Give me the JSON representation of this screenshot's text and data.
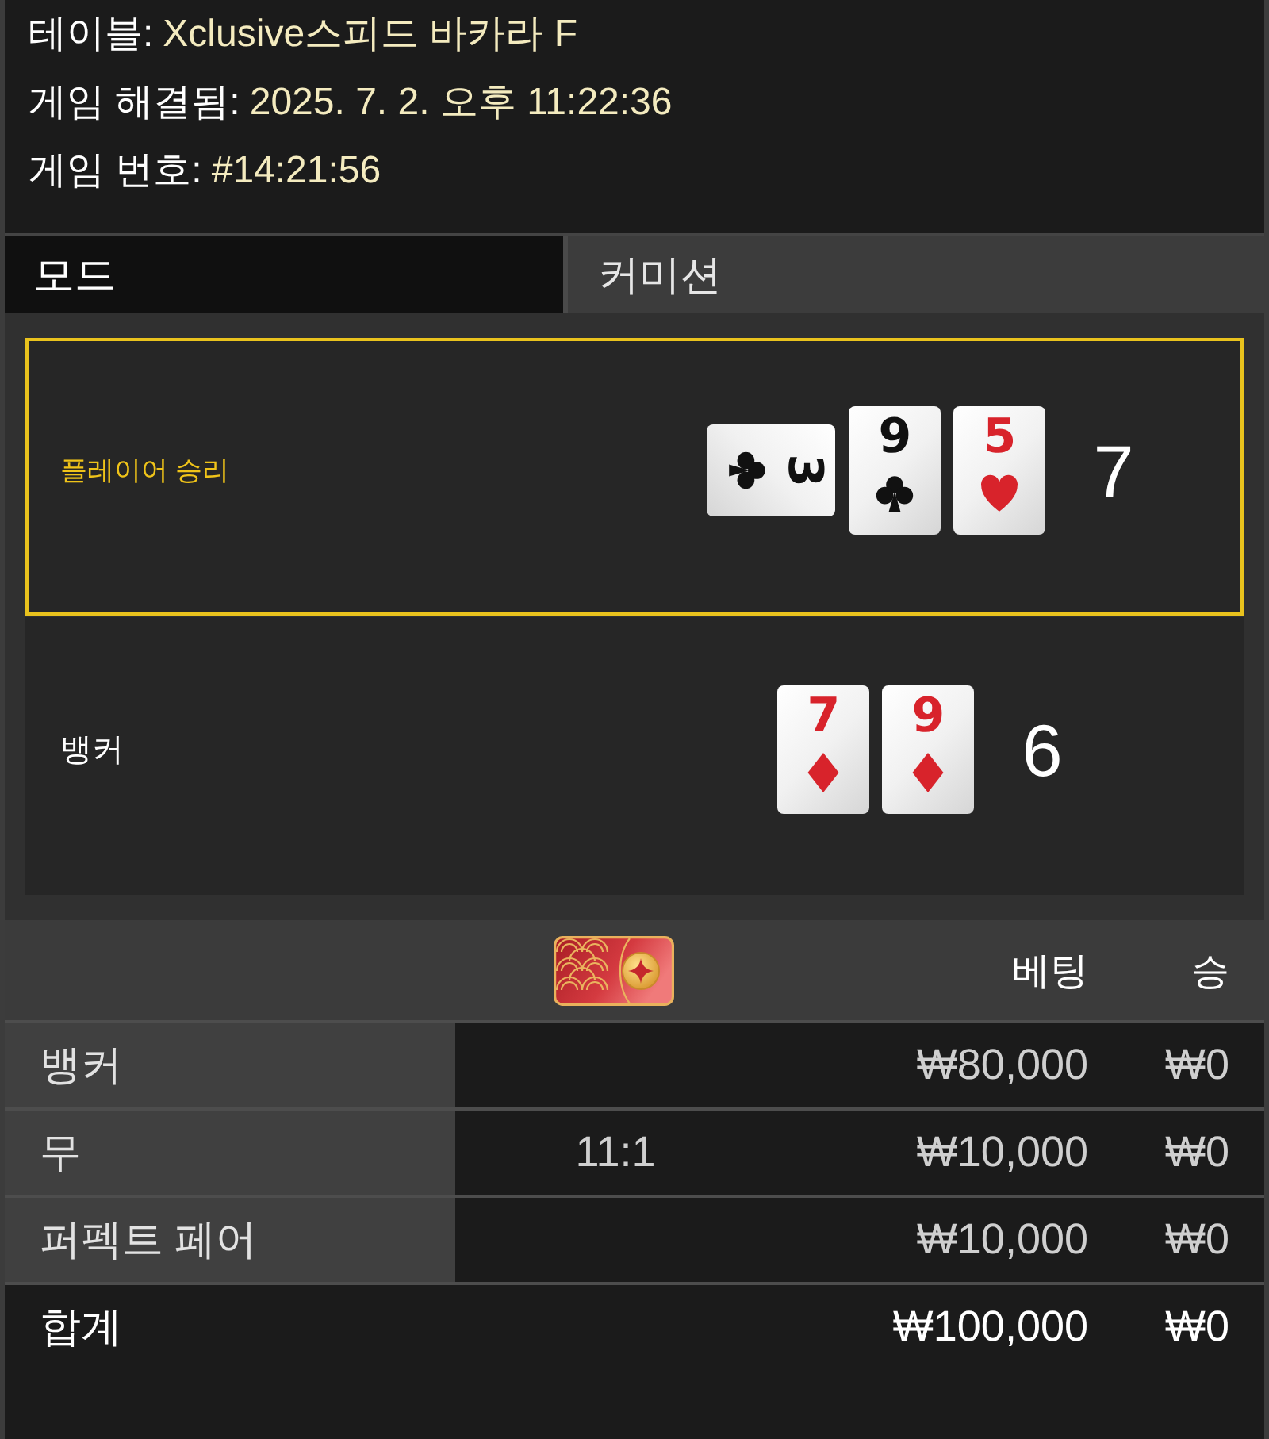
{
  "info": [
    {
      "label": "테이블:",
      "value": "Xclusive스피드 바카라 F"
    },
    {
      "label": "게임 해결됨:",
      "value": "2025. 7. 2. 오후 11:22:36"
    },
    {
      "label": "게임 번호:",
      "value": "#14:21:56"
    }
  ],
  "mode": {
    "label": "모드",
    "value": "커미션"
  },
  "hands": [
    {
      "label": "플레이어 승리",
      "winner": true,
      "cards": [
        {
          "rank": "3",
          "kind": "club",
          "sideways": true
        },
        {
          "rank": "9",
          "kind": "club",
          "sideways": false
        },
        {
          "rank": "5",
          "kind": "heart",
          "sideways": false
        }
      ],
      "score": "7"
    },
    {
      "label": "뱅커",
      "winner": false,
      "cards": [
        {
          "rank": "7",
          "kind": "diamond",
          "sideways": false
        },
        {
          "rank": "9",
          "kind": "diamond",
          "sideways": false
        }
      ],
      "score": "6"
    }
  ],
  "bets_table": {
    "columns": [
      {
        "kind": "blank"
      },
      {
        "kind": "icon"
      },
      {
        "kind": "text",
        "label": "베팅"
      },
      {
        "kind": "text",
        "label": "승"
      }
    ],
    "rows": [
      {
        "label": "뱅커",
        "bet": "₩80,000",
        "win": "₩0"
      },
      {
        "label": "무",
        "odds": "11:1",
        "bet": "₩10,000",
        "win": "₩0"
      },
      {
        "label": "퍼펙트 페어",
        "bet": "₩10,000",
        "win": "₩0"
      }
    ],
    "total": {
      "label": "합계",
      "bet": "₩100,000",
      "win": "₩0"
    }
  }
}
